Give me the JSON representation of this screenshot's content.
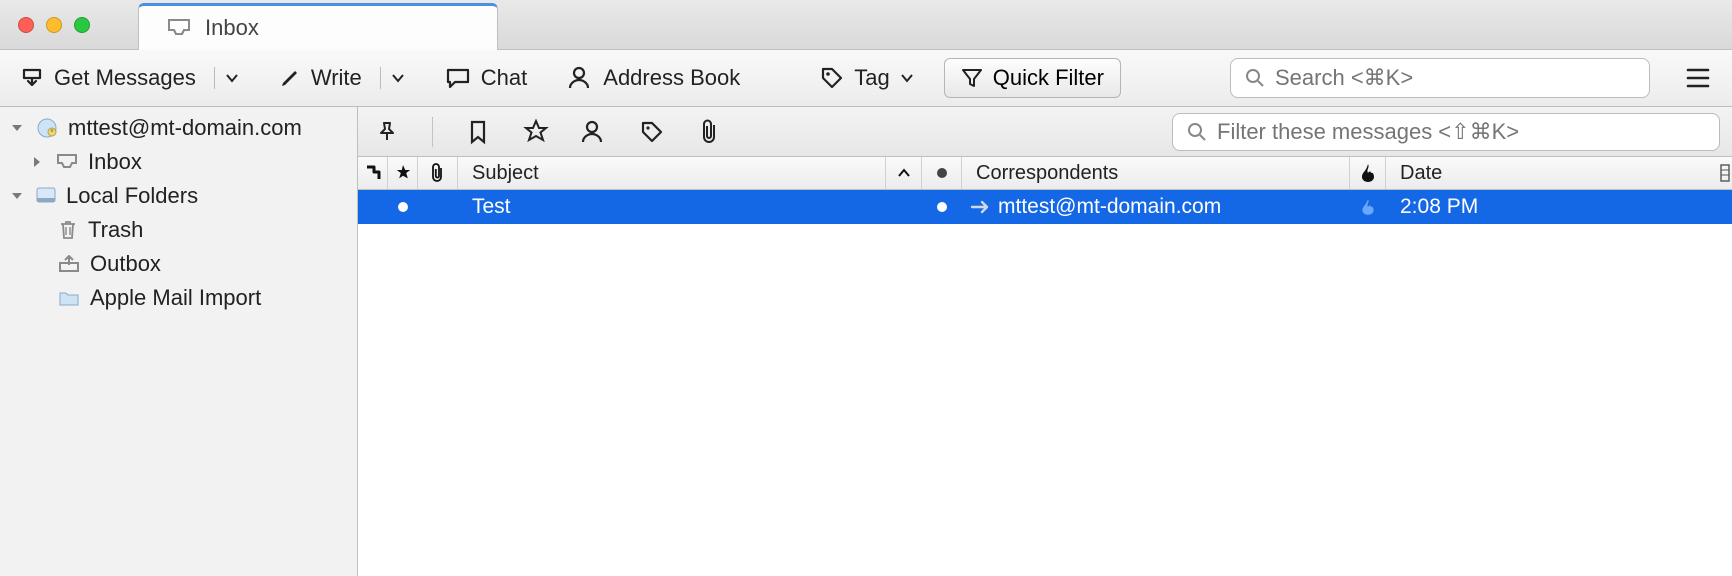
{
  "tab": {
    "title": "Inbox"
  },
  "toolbar": {
    "get_messages": "Get Messages",
    "write": "Write",
    "chat": "Chat",
    "address_book": "Address Book",
    "tag": "Tag",
    "quick_filter": "Quick Filter",
    "search_placeholder": "Search <⌘K>"
  },
  "sidebar": {
    "account": "mttest@mt-domain.com",
    "inbox": "Inbox",
    "local_folders": "Local Folders",
    "trash": "Trash",
    "outbox": "Outbox",
    "apple_mail_import": "Apple Mail Import"
  },
  "filter": {
    "placeholder": "Filter these messages <⇧⌘K>"
  },
  "columns": {
    "subject": "Subject",
    "correspondents": "Correspondents",
    "date": "Date"
  },
  "messages": [
    {
      "subject": "Test",
      "correspondent": "mttest@mt-domain.com",
      "date": "2:08 PM",
      "unread": true,
      "selected": true
    }
  ]
}
